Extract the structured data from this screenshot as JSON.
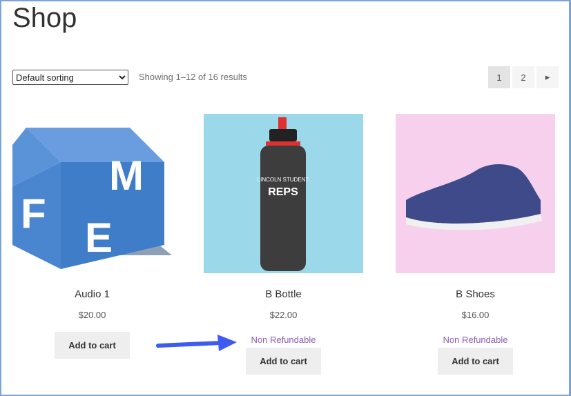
{
  "page_title": "Shop",
  "sorting": {
    "selected": "Default sorting"
  },
  "result_count": "Showing 1–12 of 16 results",
  "pagination": {
    "pages": [
      "1",
      "2"
    ],
    "current": "1",
    "next_icon": "caret-right-icon"
  },
  "products": [
    {
      "name": "Audio 1",
      "price": "$20.00",
      "badge": "",
      "button": "Add to cart",
      "image_bg": "#ffffff"
    },
    {
      "name": "B Bottle",
      "price": "$22.00",
      "badge": "Non Refundable",
      "button": "Add to cart",
      "image_bg": "#9bd8ea"
    },
    {
      "name": "B Shoes",
      "price": "$16.00",
      "badge": "Non Refundable",
      "button": "Add to cart",
      "image_bg": "#f7d0ee"
    }
  ],
  "annotation": {
    "icon": "arrow-right-icon",
    "color": "#3d5af1"
  },
  "colors": {
    "accent": "#8f5db8",
    "frame": "#7aa3d6"
  }
}
